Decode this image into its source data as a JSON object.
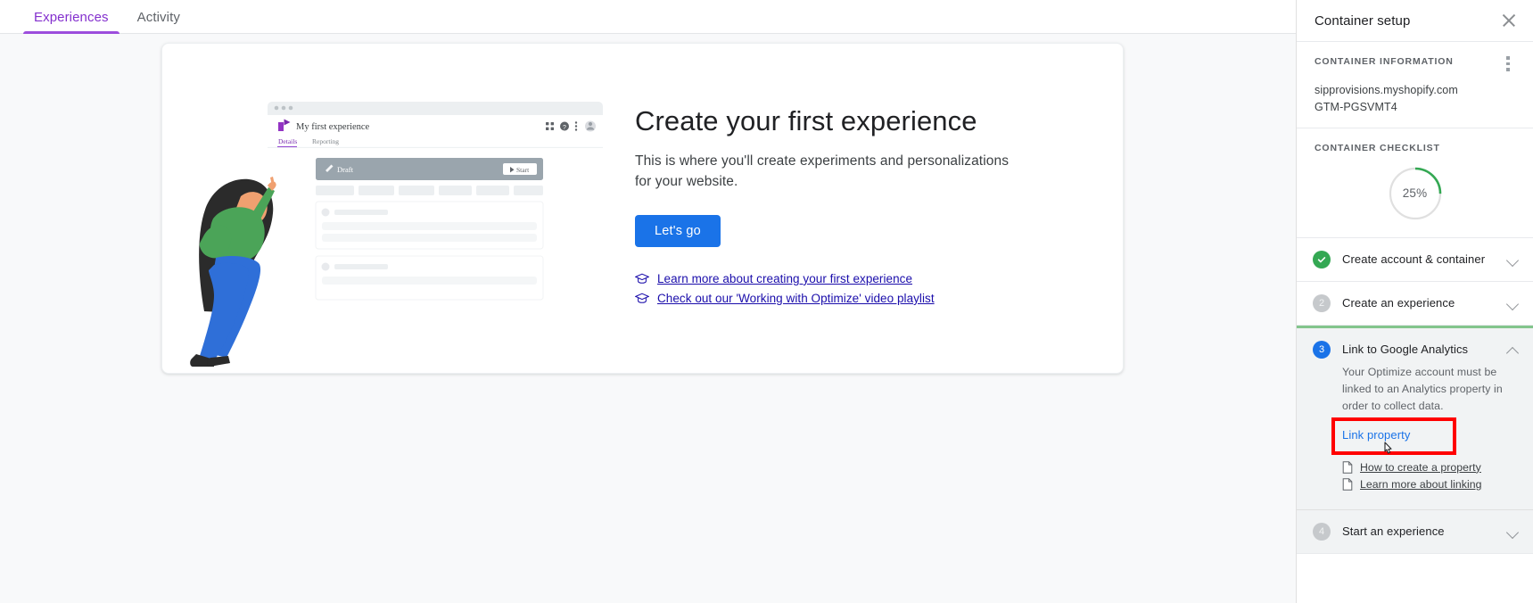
{
  "topbar": {
    "tabs": [
      {
        "label": "Experiences",
        "active": true
      },
      {
        "label": "Activity",
        "active": false
      }
    ]
  },
  "main": {
    "headline": "Create your first experience",
    "subtext": "This is where you'll create experiments and personalizations for your website.",
    "cta_label": "Let's go",
    "links": [
      {
        "label": "Learn more about creating your first experience",
        "icon": "graduation-cap-icon"
      },
      {
        "label": "Check out our 'Working with Optimize' video playlist",
        "icon": "graduation-cap-icon"
      }
    ],
    "illustration": {
      "window_title": "My first experience",
      "tabs": [
        "Details",
        "Reporting"
      ],
      "banner_label": "Draft",
      "banner_button": "Start"
    }
  },
  "panel": {
    "title": "Container setup",
    "close_icon": "close-icon",
    "menu_icon": "kebab-menu-icon",
    "container_information": {
      "label": "CONTAINER INFORMATION",
      "domain": "sipprovisions.myshopify.com",
      "container_id": "GTM-PGSVMT4"
    },
    "checklist": {
      "label": "CONTAINER CHECKLIST",
      "percent_text": "25%",
      "percent_value": 25,
      "ring_color": "#34a853",
      "ring_track_color": "#e0e0e0"
    },
    "steps": [
      {
        "number": "1",
        "title": "Create account & container",
        "state": "done",
        "expanded": false,
        "chevron": "chevron-down-icon"
      },
      {
        "number": "2",
        "title": "Create an experience",
        "state": "todo",
        "expanded": false,
        "chevron": "chevron-down-icon"
      },
      {
        "number": "3",
        "title": "Link to Google Analytics",
        "state": "current",
        "expanded": true,
        "chevron": "chevron-up-icon",
        "description": "Your Optimize account must be linked to an Analytics property in order to collect data.",
        "action_label": "Link property",
        "doc_links": [
          {
            "label": "How to create a property",
            "icon": "document-icon"
          },
          {
            "label": "Learn more about linking",
            "icon": "document-icon"
          }
        ]
      },
      {
        "number": "4",
        "title": "Start an experience",
        "state": "todo",
        "expanded": false,
        "chevron": "chevron-down-icon"
      }
    ]
  },
  "annotation": {
    "highlight_color": "#ff0000",
    "cursor_icon": "pointer-cursor-icon"
  }
}
